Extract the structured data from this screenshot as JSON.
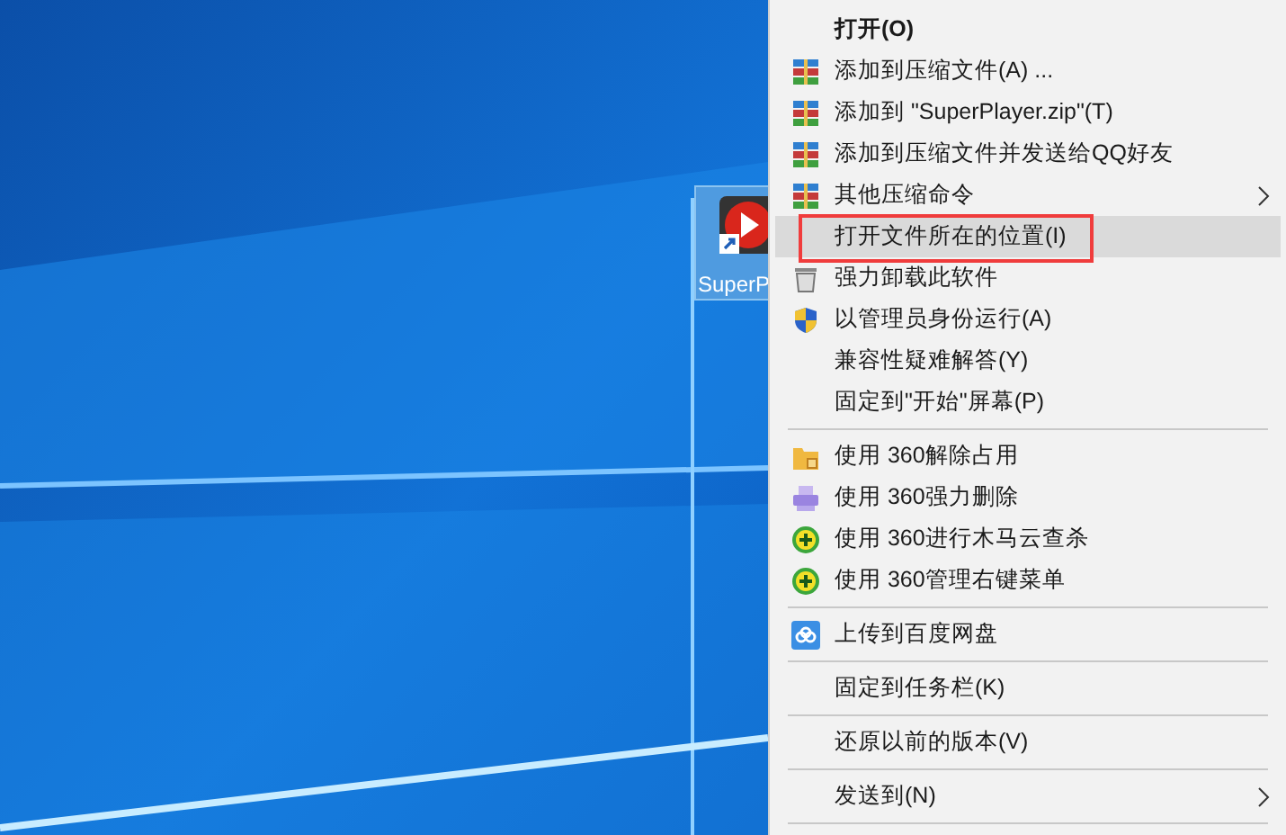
{
  "desktop_icon": {
    "label": "SuperP",
    "selected": true
  },
  "menu": {
    "items": [
      {
        "kind": "plain",
        "label": "打开(O)",
        "bold": true,
        "submenu": false,
        "selected": false
      },
      {
        "kind": "archive",
        "label": "添加到压缩文件(A) ...",
        "bold": false,
        "submenu": false,
        "selected": false
      },
      {
        "kind": "archive",
        "label": "添加到 \"SuperPlayer.zip\"(T)",
        "bold": false,
        "submenu": false,
        "selected": false
      },
      {
        "kind": "archive",
        "label": "添加到压缩文件并发送给QQ好友",
        "bold": false,
        "submenu": false,
        "selected": false
      },
      {
        "kind": "archive",
        "label": "其他压缩命令",
        "bold": false,
        "submenu": true,
        "selected": false
      },
      {
        "kind": "plain",
        "label": "打开文件所在的位置(I)",
        "bold": false,
        "submenu": false,
        "selected": true
      },
      {
        "kind": "trash",
        "label": "强力卸载此软件",
        "bold": false,
        "submenu": false,
        "selected": false
      },
      {
        "kind": "shield",
        "label": "以管理员身份运行(A)",
        "bold": false,
        "submenu": false,
        "selected": false
      },
      {
        "kind": "plain",
        "label": "兼容性疑难解答(Y)",
        "bold": false,
        "submenu": false,
        "selected": false
      },
      {
        "kind": "plain",
        "label": "固定到\"开始\"屏幕(P)",
        "bold": false,
        "submenu": false,
        "selected": false
      },
      {
        "kind": "separator"
      },
      {
        "kind": "folder",
        "label": "使用 360解除占用",
        "bold": false,
        "submenu": false,
        "selected": false
      },
      {
        "kind": "shredder",
        "label": "使用 360强力删除",
        "bold": false,
        "submenu": false,
        "selected": false
      },
      {
        "kind": "plus",
        "label": "使用 360进行木马云查杀",
        "bold": false,
        "submenu": false,
        "selected": false
      },
      {
        "kind": "plus",
        "label": "使用 360管理右键菜单",
        "bold": false,
        "submenu": false,
        "selected": false
      },
      {
        "kind": "separator"
      },
      {
        "kind": "cloud",
        "label": "上传到百度网盘",
        "bold": false,
        "submenu": false,
        "selected": false
      },
      {
        "kind": "separator"
      },
      {
        "kind": "plain",
        "label": "固定到任务栏(K)",
        "bold": false,
        "submenu": false,
        "selected": false
      },
      {
        "kind": "separator"
      },
      {
        "kind": "plain",
        "label": "还原以前的版本(V)",
        "bold": false,
        "submenu": false,
        "selected": false
      },
      {
        "kind": "separator"
      },
      {
        "kind": "plain",
        "label": "发送到(N)",
        "bold": false,
        "submenu": true,
        "selected": false
      },
      {
        "kind": "separator"
      }
    ]
  }
}
